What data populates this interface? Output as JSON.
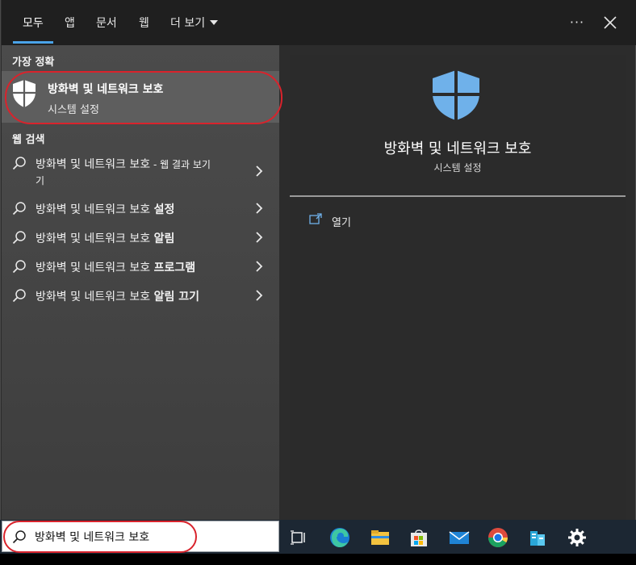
{
  "tabs": [
    {
      "id": "all",
      "label": "모두",
      "active": true
    },
    {
      "id": "apps",
      "label": "앱",
      "active": false
    },
    {
      "id": "docs",
      "label": "문서",
      "active": false
    },
    {
      "id": "web",
      "label": "웹",
      "active": false
    },
    {
      "id": "more",
      "label": "더 보기",
      "active": false
    }
  ],
  "header": {
    "more_options_label": "···"
  },
  "best_match": {
    "section_title": "가장 정확",
    "name": "방화벽 및 네트워크 보호",
    "subtitle": "시스템 설정",
    "icon": "shield-icon"
  },
  "web_search": {
    "section_title": "웹 검색",
    "results": [
      {
        "prefix": "방화벽 및 네트워크 보호",
        "suffix": " - 웹 결과 보기",
        "suffix2": "기",
        "bold": false
      },
      {
        "prefix": "방화벽 및 네트워크 보호 ",
        "suffix": "설정",
        "bold": true
      },
      {
        "prefix": "방화벽 및 네트워크 보호 ",
        "suffix": "알림",
        "bold": true
      },
      {
        "prefix": "방화벽 및 네트워크 보호 ",
        "suffix": "프로그램",
        "bold": true
      },
      {
        "prefix": "방화벽 및 네트워크 보호 ",
        "suffix": "알림 끄기",
        "bold": true
      }
    ]
  },
  "detail": {
    "title": "방화벽 및 네트워크 보호",
    "subtitle": "시스템 설정",
    "actions": [
      {
        "label": "열기",
        "icon": "open-window-icon"
      }
    ]
  },
  "search": {
    "value": "방화벽 및 네트워크 보호",
    "icon": "search-icon"
  },
  "taskbar": {
    "apps": [
      "task-view-icon",
      "edge-icon",
      "file-explorer-icon",
      "store-icon",
      "mail-icon",
      "chrome-icon",
      "azure-storage-icon",
      "settings-icon"
    ]
  },
  "colors": {
    "accent": "#4aa3e8",
    "highlight_ring": "#d9232c",
    "shield_blue": "#6fb1ea"
  }
}
